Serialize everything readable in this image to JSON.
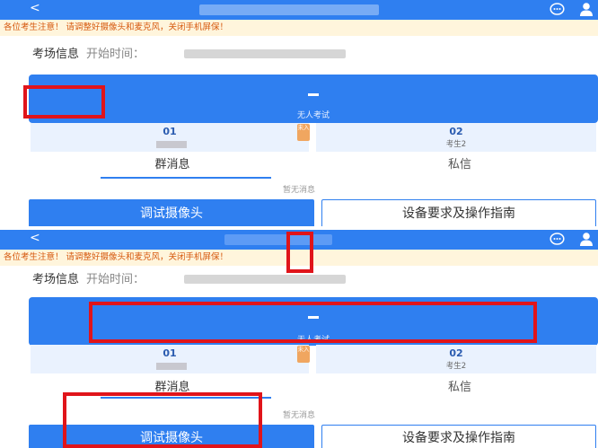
{
  "header": {
    "back_label": "<"
  },
  "notice": "各位考生注意！ 请调整好摄像头和麦克风，关闭手机屏保！",
  "exam_info": {
    "label": "考场信息",
    "start_label": "开始时间："
  },
  "exam_panel": {
    "dash": "—",
    "no_exam_text": "无人考试"
  },
  "seats": [
    {
      "number": "01",
      "name": "",
      "badge": "未入"
    },
    {
      "number": "02",
      "name": "考生2"
    }
  ],
  "tabs": [
    {
      "label": "群消息"
    },
    {
      "label": "私信"
    }
  ],
  "messages": {
    "empty_text": "暂无消息"
  },
  "buttons": {
    "debug_camera": "调试摄像头",
    "device_guide": "设备要求及操作指南"
  },
  "colors": {
    "primary": "#2f7ff0",
    "highlight": "#e0141a",
    "notice_text": "#d65a0f",
    "notice_bg": "#fff5dc"
  }
}
